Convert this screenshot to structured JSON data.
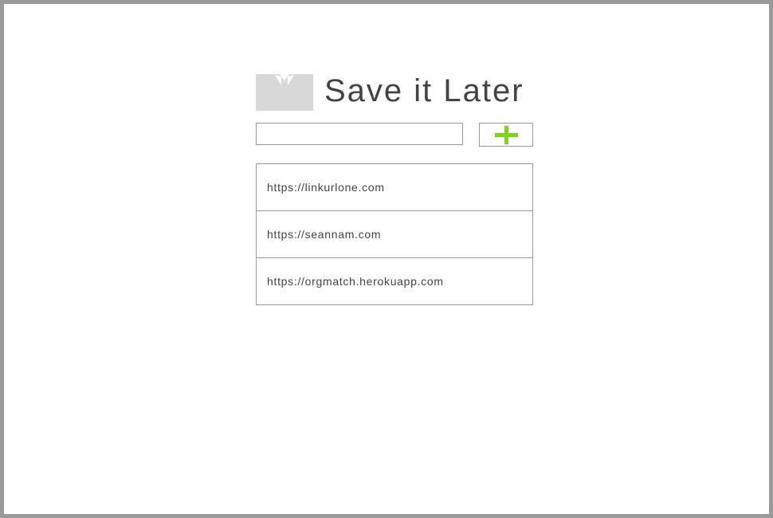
{
  "app": {
    "title": "Save it Later",
    "logo_icon": "book-icon",
    "logo_color": "#d8d8d8"
  },
  "form": {
    "input_value": "",
    "add_icon": "plus-icon",
    "accent_color": "#7ed321"
  },
  "links": [
    {
      "url": "https://linkurlone.com"
    },
    {
      "url": "https://seannam.com"
    },
    {
      "url": "https://orgmatch.herokuapp.com"
    }
  ]
}
